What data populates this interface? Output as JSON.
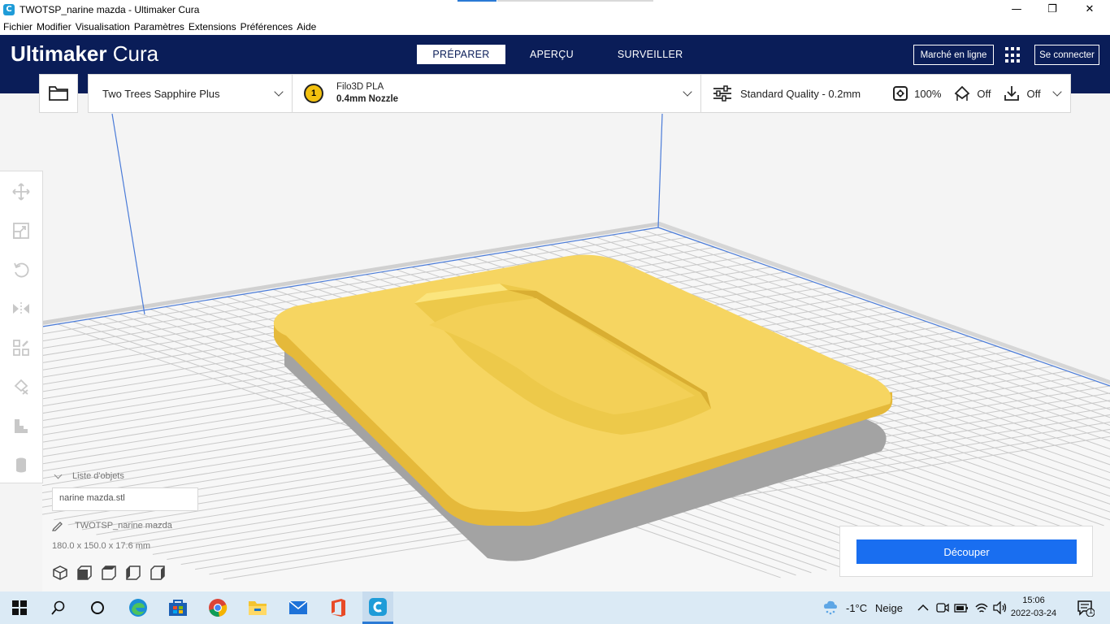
{
  "window": {
    "title": "TWOTSP_narine mazda - Ultimaker Cura",
    "app_icon_letter": "C",
    "minimize": "—",
    "maximize": "❐",
    "close": "✕"
  },
  "menu": [
    "Fichier",
    "Modifier",
    "Visualisation",
    "Paramètres",
    "Extensions",
    "Préférences",
    "Aide"
  ],
  "header": {
    "logo_bold": "Ultimaker",
    "logo_light": "Cura",
    "tabs": [
      "PRÉPARER",
      "APERÇU",
      "SURVEILLER"
    ],
    "active_tab": "PRÉPARER",
    "marketplace": "Marché en ligne",
    "sign_in": "Se connecter"
  },
  "toolbar": {
    "printer": "Two Trees Sapphire Plus",
    "extruder_number": "1",
    "material": "Filo3D PLA",
    "nozzle": "0.4mm Nozzle",
    "quality": "Standard Quality - 0.2mm",
    "infill": "100%",
    "support": "Off",
    "adhesion": "Off"
  },
  "tools": [
    "move-icon",
    "scale-icon",
    "rotate-icon",
    "mirror-icon",
    "per-model-settings-icon",
    "support-blocker-icon",
    "stairs-icon",
    "cylinder-icon"
  ],
  "object_list": {
    "heading": "Liste d'objets",
    "item": "narine mazda.stl",
    "job_name": "TWOTSP_narine mazda",
    "dimensions": "180.0 x 150.0 x 17.6 mm"
  },
  "slice": {
    "button": "Découper"
  },
  "taskbar": {
    "weather_temp": "-1°C",
    "weather_desc": "Neige",
    "time": "15:06",
    "date": "2022-03-24",
    "notification_count": "1"
  },
  "colors": {
    "header_bg": "#0a1d58",
    "accent_blue": "#196ef0",
    "model_yellow": "#f5d35a",
    "build_plate_grid": "#c8c8c8"
  }
}
